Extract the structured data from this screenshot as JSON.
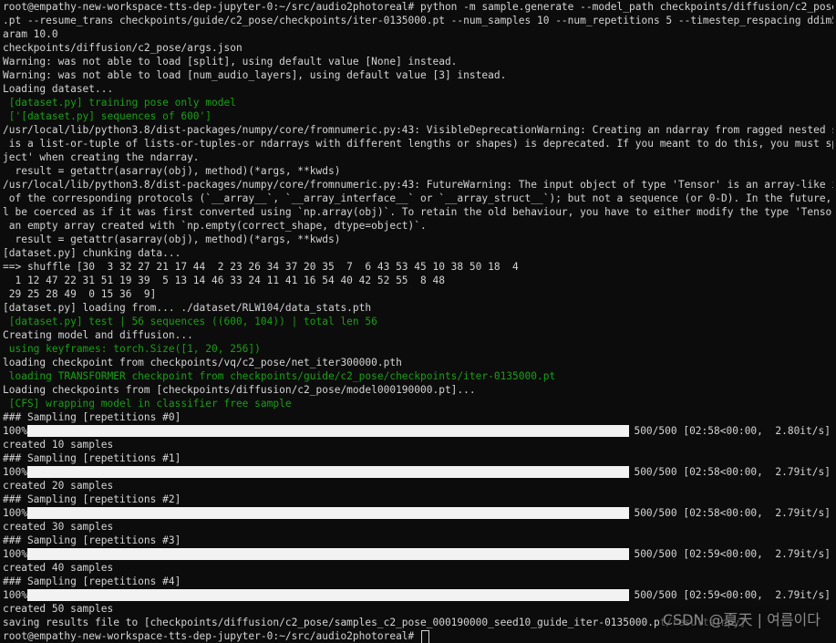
{
  "lines": [
    {
      "text": "root@empathy-new-workspace-tts-dep-jupyter-0:~/src/audio2photoreal# python -m sample.generate --model_path checkpoints/diffusion/c2_pose/model000190000"
    },
    {
      "text": ".pt --resume_trans checkpoints/guide/c2_pose/checkpoints/iter-0135000.pt --num_samples 10 --num_repetitions 5 --timestep_respacing ddim500 --guidance_p"
    },
    {
      "text": "aram 10.0"
    },
    {
      "text": "checkpoints/diffusion/c2_pose/args.json"
    },
    {
      "text": "Warning: was not able to load [split], using default value [None] instead."
    },
    {
      "text": "Warning: was not able to load [num_audio_layers], using default value [3] instead."
    },
    {
      "text": "Loading dataset..."
    },
    {
      "text": " [dataset.py] training pose only model",
      "green": true
    },
    {
      "text": " ['[dataset.py] sequences of 600']",
      "green": true
    },
    {
      "text": "/usr/local/lib/python3.8/dist-packages/numpy/core/fromnumeric.py:43: VisibleDeprecationWarning: Creating an ndarray from ragged nested sequences (which"
    },
    {
      "text": " is a list-or-tuple of lists-or-tuples-or ndarrays with different lengths or shapes) is deprecated. If you meant to do this, you must specify 'dtype=ob"
    },
    {
      "text": "ject' when creating the ndarray."
    },
    {
      "text": "  result = getattr(asarray(obj), method)(*args, **kwds)"
    },
    {
      "text": "/usr/local/lib/python3.8/dist-packages/numpy/core/fromnumeric.py:43: FutureWarning: The input object of type 'Tensor' is an array-like implementing one"
    },
    {
      "text": " of the corresponding protocols (`__array__`, `__array_interface__` or `__array_struct__`); but not a sequence (or 0-D). In the future, this object wil"
    },
    {
      "text": "l be coerced as if it was first converted using `np.array(obj)`. To retain the old behaviour, you have to either modify the type 'Tensor', or assign to"
    },
    {
      "text": " an empty array created with `np.empty(correct_shape, dtype=object)`."
    },
    {
      "text": "  result = getattr(asarray(obj), method)(*args, **kwds)"
    },
    {
      "text": "[dataset.py] chunking data..."
    },
    {
      "text": "==> shuffle [30  3 32 27 21 17 44  2 23 26 34 37 20 35  7  6 43 53 45 10 38 50 18  4"
    },
    {
      "text": "  1 12 47 22 31 51 19 39  5 13 14 46 33 24 11 41 16 54 40 42 52 55  8 48"
    },
    {
      "text": " 29 25 28 49  0 15 36  9]"
    },
    {
      "text": "[dataset.py] loading from... ./dataset/RLW104/data_stats.pth"
    },
    {
      "text": " [dataset.py] test | 56 sequences ((600, 104)) | total len 56",
      "green": true
    },
    {
      "text": "Creating model and diffusion..."
    },
    {
      "text": " using keyframes: torch.Size([1, 20, 256])",
      "green": true
    },
    {
      "text": "loading checkpoint from checkpoints/vq/c2_pose/net_iter300000.pth"
    },
    {
      "text": " loading TRANSFORMER checkpoint from checkpoints/guide/c2_pose/checkpoints/iter-0135000.pt",
      "green": true
    },
    {
      "text": "Loading checkpoints from [checkpoints/diffusion/c2_pose/model000190000.pt]..."
    },
    {
      "text": " [CFS] wrapping model in classifier free sample",
      "green": true
    },
    {
      "text": "### Sampling [repetitions #0]"
    },
    {
      "progress": true,
      "pct": "100%",
      "progress_fraction": 1.0,
      "stats": "500/500 [02:58<00:00,  2.80it/s]"
    },
    {
      "text": "created 10 samples"
    },
    {
      "text": "### Sampling [repetitions #1]"
    },
    {
      "progress": true,
      "pct": "100%",
      "progress_fraction": 1.0,
      "stats": "500/500 [02:58<00:00,  2.79it/s]"
    },
    {
      "text": "created 20 samples"
    },
    {
      "text": "### Sampling [repetitions #2]"
    },
    {
      "progress": true,
      "pct": "100%",
      "progress_fraction": 1.0,
      "stats": "500/500 [02:58<00:00,  2.79it/s]"
    },
    {
      "text": "created 30 samples"
    },
    {
      "text": "### Sampling [repetitions #3]"
    },
    {
      "progress": true,
      "pct": "100%",
      "progress_fraction": 1.0,
      "stats": "500/500 [02:59<00:00,  2.79it/s]"
    },
    {
      "text": "created 40 samples"
    },
    {
      "text": "### Sampling [repetitions #4]"
    },
    {
      "progress": true,
      "pct": "100%",
      "progress_fraction": 1.0,
      "stats": "500/500 [02:59<00:00,  2.79it/s]"
    },
    {
      "text": "created 50 samples"
    },
    {
      "text": "saving results file to [checkpoints/diffusion/c2_pose/samples_c2_pose_000190000_seed10_guide_iter-0135000.pt/results.npy]"
    },
    {
      "text": "root@empathy-new-workspace-tts-dep-jupyter-0:~/src/audio2photoreal# ",
      "prompt": true
    }
  ],
  "watermark": "CSDN @夏天 | 여름이다",
  "colors": {
    "background": "#0c0c0c",
    "text": "#d4d4d4",
    "green": "#13a10e",
    "bar": "#f2f2f2"
  }
}
